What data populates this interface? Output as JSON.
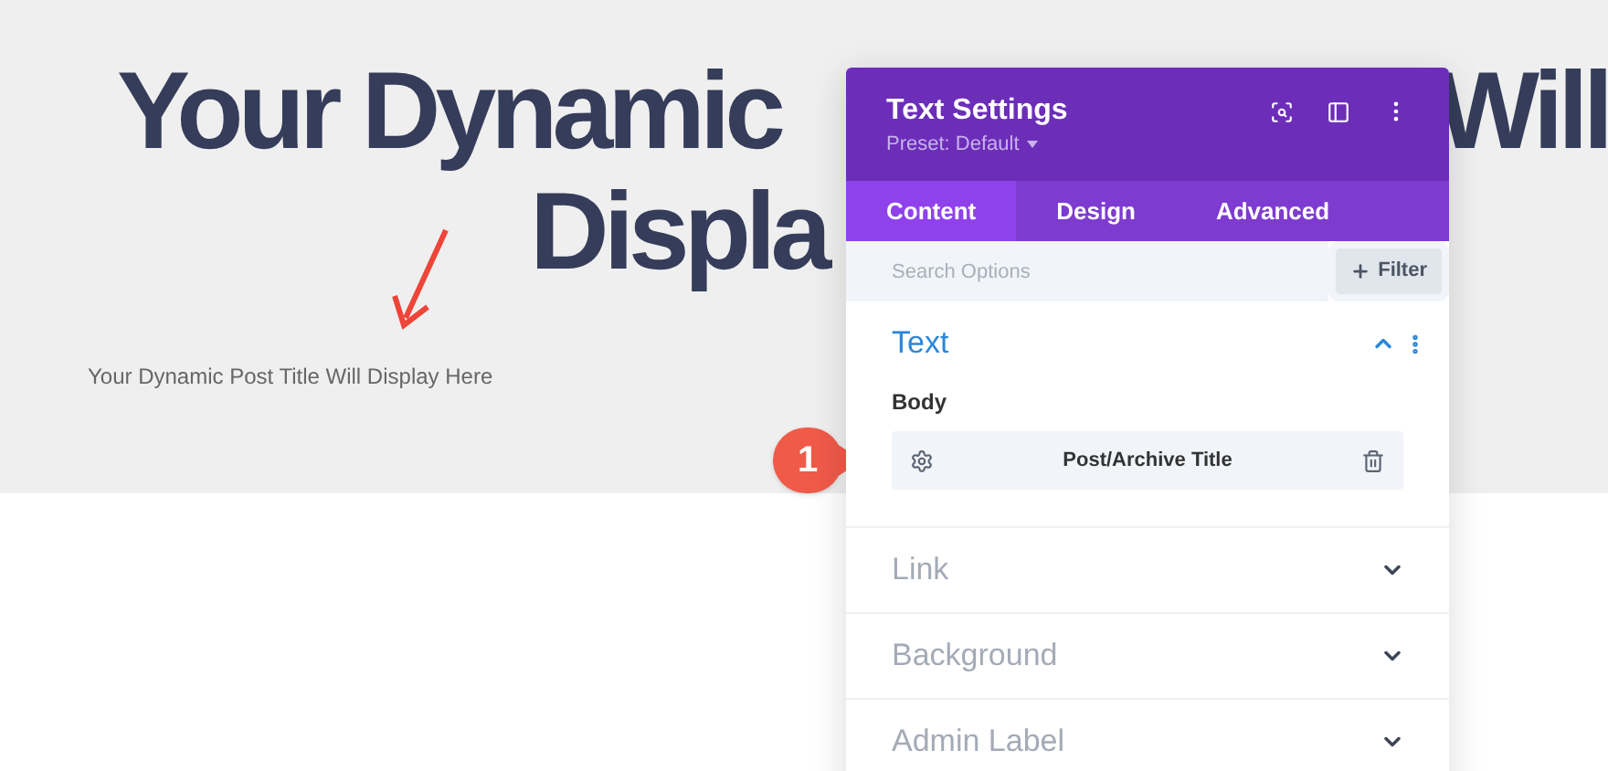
{
  "heading": {
    "line_1": [
      "Your Dynamic",
      "Will"
    ],
    "line_2": "Displa"
  },
  "caption": "Your Dynamic Post Title Will Display Here",
  "callout": {
    "number": "1"
  },
  "panel": {
    "title": "Text Settings",
    "preset": "Preset: Default",
    "tabs": [
      {
        "label": "Content",
        "selected": true
      },
      {
        "label": "Design",
        "selected": false
      },
      {
        "label": "Advanced",
        "selected": false
      }
    ],
    "search": {
      "placeholder": "Search Options"
    },
    "filter_button": "Filter",
    "sections": [
      {
        "title": "Text",
        "expanded": true,
        "field_label": "Body",
        "dynamic_value": "Post/Archive Title"
      },
      {
        "title": "Link",
        "expanded": false
      },
      {
        "title": "Background",
        "expanded": false
      },
      {
        "title": "Admin Label",
        "expanded": false
      }
    ]
  }
}
